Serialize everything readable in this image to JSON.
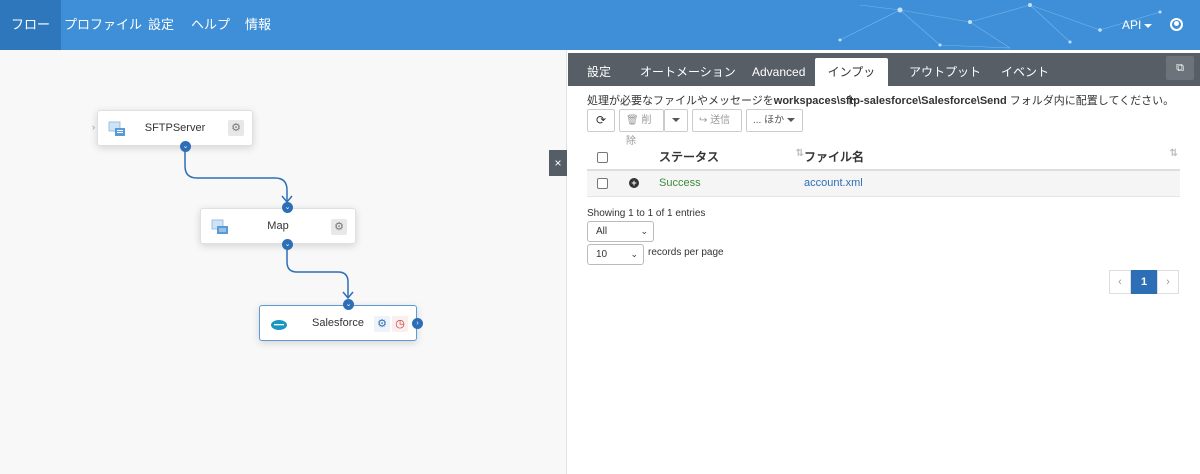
{
  "nav": {
    "items": [
      {
        "label": "フロー",
        "active": true
      },
      {
        "label": "プロファイル"
      },
      {
        "label": "設定"
      },
      {
        "label": "ヘルプ"
      },
      {
        "label": "情報"
      }
    ],
    "api_label": "API",
    "user_icon": "user-circle-icon"
  },
  "flow": {
    "nodes": [
      {
        "label": "SFTPServer",
        "icon": "sftp-server-icon"
      },
      {
        "label": "Map",
        "icon": "map-icon"
      },
      {
        "label": "Salesforce",
        "icon": "salesforce-cloud-icon"
      }
    ],
    "collapse_glyph": "×"
  },
  "panel": {
    "tabs": [
      {
        "label": "設定"
      },
      {
        "label": "オートメーション"
      },
      {
        "label": "Advanced"
      },
      {
        "label": "インプット",
        "active": true
      },
      {
        "label": "アウトプット"
      },
      {
        "label": "イベント"
      }
    ],
    "info_prefix": "処理が必要なファイルやメッセージを",
    "info_path": "workspaces\\sftp-salesforce\\Salesforce\\Send",
    "info_suffix": " フォルダ内に配置してください。",
    "toolbar": {
      "refresh_icon": "refresh-icon",
      "delete_label": "削除",
      "send_label": "送信",
      "more_label": "... ほか"
    },
    "table": {
      "headers": {
        "status": "ステータス",
        "filename": "ファイル名"
      },
      "rows": [
        {
          "status": "Success",
          "filename": "account.xml"
        }
      ]
    },
    "showing": "Showing 1 to 1 of 1 entries",
    "filter_value": "All",
    "page_size_value": "10",
    "records_per_page": "records per page",
    "pagination": {
      "prev": "‹",
      "current": "1",
      "next": "›"
    }
  },
  "colors": {
    "nav_bg": "#3f8fd8",
    "nav_active": "#2f77bd",
    "tabbar_bg": "#575e66",
    "accent": "#2d6fb6",
    "success": "#3c8a3c"
  }
}
